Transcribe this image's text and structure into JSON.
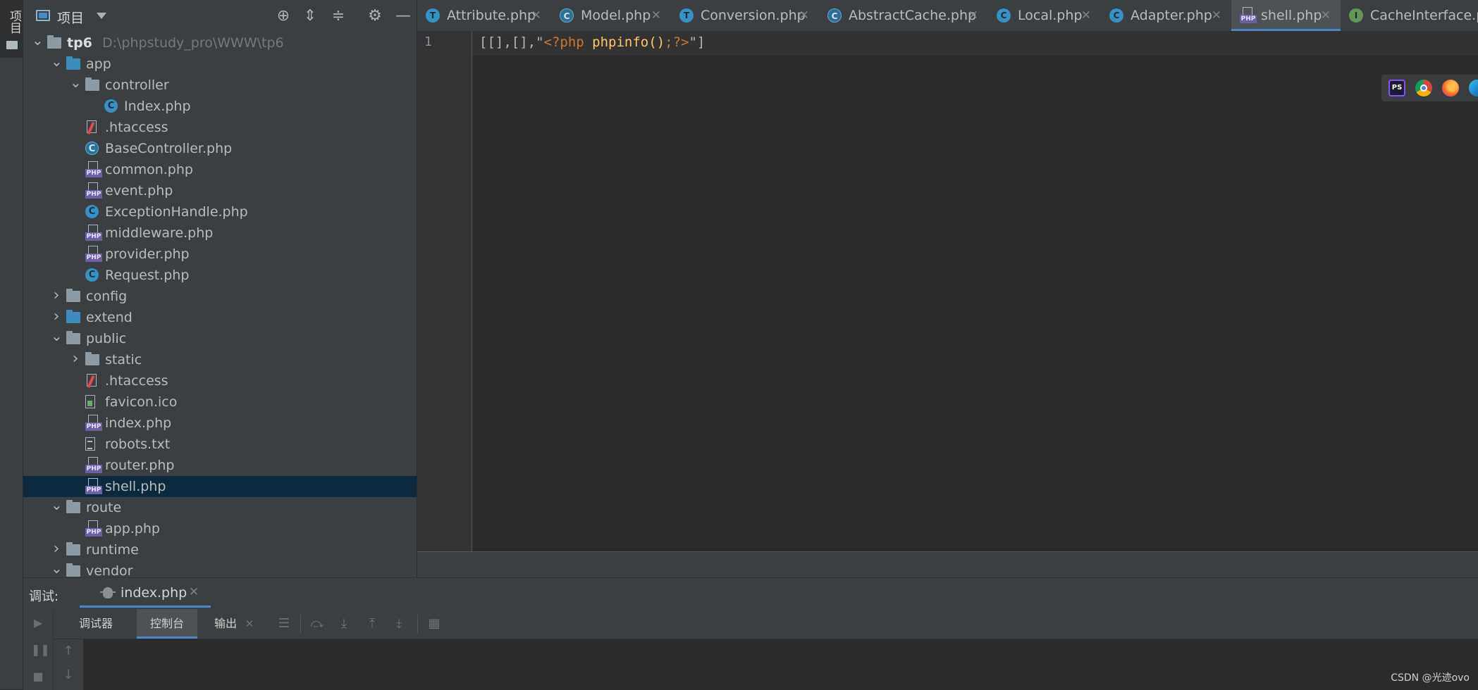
{
  "left_strip": {
    "label": "项目"
  },
  "project_panel": {
    "title": "项目",
    "tree": [
      {
        "name": "tp6",
        "path": "D:\\phpstudy_pro\\WWW\\tp6",
        "type": "folder",
        "depth": 0,
        "expanded": true,
        "bold": true
      },
      {
        "name": "app",
        "type": "folder-blue",
        "depth": 1,
        "expanded": true
      },
      {
        "name": "controller",
        "type": "folder",
        "depth": 2,
        "expanded": true
      },
      {
        "name": "Index.php",
        "type": "class",
        "depth": 3
      },
      {
        "name": ".htaccess",
        "type": "htaccess",
        "depth": 2
      },
      {
        "name": "BaseController.php",
        "type": "class-ring",
        "depth": 2
      },
      {
        "name": "common.php",
        "type": "php",
        "depth": 2
      },
      {
        "name": "event.php",
        "type": "php",
        "depth": 2
      },
      {
        "name": "ExceptionHandle.php",
        "type": "class",
        "depth": 2
      },
      {
        "name": "middleware.php",
        "type": "php",
        "depth": 2
      },
      {
        "name": "provider.php",
        "type": "php",
        "depth": 2
      },
      {
        "name": "Request.php",
        "type": "class",
        "depth": 2
      },
      {
        "name": "config",
        "type": "folder",
        "depth": 1,
        "expanded": false
      },
      {
        "name": "extend",
        "type": "folder-blue",
        "depth": 1,
        "expanded": false
      },
      {
        "name": "public",
        "type": "folder",
        "depth": 1,
        "expanded": true
      },
      {
        "name": "static",
        "type": "folder",
        "depth": 2,
        "expanded": false
      },
      {
        "name": ".htaccess",
        "type": "htaccess",
        "depth": 2
      },
      {
        "name": "favicon.ico",
        "type": "ico",
        "depth": 2
      },
      {
        "name": "index.php",
        "type": "php",
        "depth": 2
      },
      {
        "name": "robots.txt",
        "type": "txt",
        "depth": 2
      },
      {
        "name": "router.php",
        "type": "php",
        "depth": 2
      },
      {
        "name": "shell.php",
        "type": "php",
        "depth": 2,
        "selected": true
      },
      {
        "name": "route",
        "type": "folder",
        "depth": 1,
        "expanded": true
      },
      {
        "name": "app.php",
        "type": "php",
        "depth": 2
      },
      {
        "name": "runtime",
        "type": "folder",
        "depth": 1,
        "expanded": false
      },
      {
        "name": "vendor",
        "type": "folder",
        "depth": 1,
        "expanded": true
      }
    ]
  },
  "editor_tabs": [
    {
      "label": "Attribute.php",
      "icon": "trait",
      "glyph": "T"
    },
    {
      "label": "Model.php",
      "icon": "class-ring",
      "glyph": "C"
    },
    {
      "label": "Conversion.php",
      "icon": "trait",
      "glyph": "T"
    },
    {
      "label": "AbstractCache.php",
      "icon": "class-ring",
      "glyph": "C"
    },
    {
      "label": "Local.php",
      "icon": "class",
      "glyph": "C"
    },
    {
      "label": "Adapter.php",
      "icon": "class",
      "glyph": "C"
    },
    {
      "label": "shell.php",
      "icon": "php",
      "active": true
    },
    {
      "label": "CacheInterface.php",
      "icon": "interface",
      "glyph": "I"
    }
  ],
  "editor": {
    "line_number": "1",
    "code": {
      "p1": "[[],[],\"",
      "open_tag": "<?php",
      "space": " ",
      "func": "phpinfo",
      "parens": "()",
      "semi": ";",
      "close_tag": "?>",
      "p2": "\"]"
    }
  },
  "browser_icons": [
    {
      "name": "phpstorm",
      "label": "PS"
    },
    {
      "name": "chrome"
    },
    {
      "name": "firefox"
    },
    {
      "name": "edge"
    }
  ],
  "debug": {
    "title": "调试:",
    "session_tab": "index.php",
    "tabs": [
      "调试器",
      "控制台",
      "输出"
    ],
    "active_tab": "控制台"
  },
  "watermark": "CSDN @光迹ovo",
  "colors": {
    "accent": "#4a88c7",
    "selection": "#0d293e",
    "background": "#2b2b2b"
  }
}
